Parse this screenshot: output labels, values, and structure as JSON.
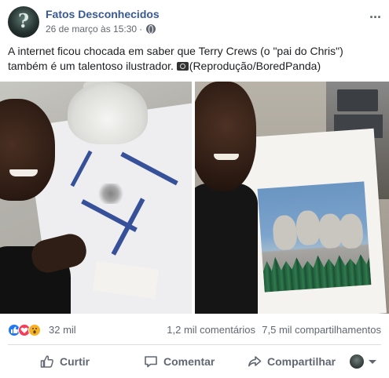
{
  "post": {
    "page_name": "Fatos Desconhecidos",
    "timestamp": "26 de março às 15:30",
    "separator": "·",
    "text_line1": "A internet ficou chocada em saber que Terry Crews (o \"pai do Chris\")",
    "text_line2_prefix": "também é um talentoso ilustrador. ",
    "text_line2_suffix": "(Reprodução/BoredPanda)",
    "avatar_glyph": "?"
  },
  "stats": {
    "reactions_count": "32 mil",
    "comments": "1,2 mil comentários",
    "shares": "7,5 mil compartilhamentos"
  },
  "actions": {
    "like": "Curtir",
    "comment": "Comentar",
    "share": "Compartilhar"
  },
  "colors": {
    "link": "#385898",
    "muted": "#606770",
    "like_blue": "#2078f4",
    "love_red": "#f33e58",
    "wow_yellow": "#f7b125"
  }
}
